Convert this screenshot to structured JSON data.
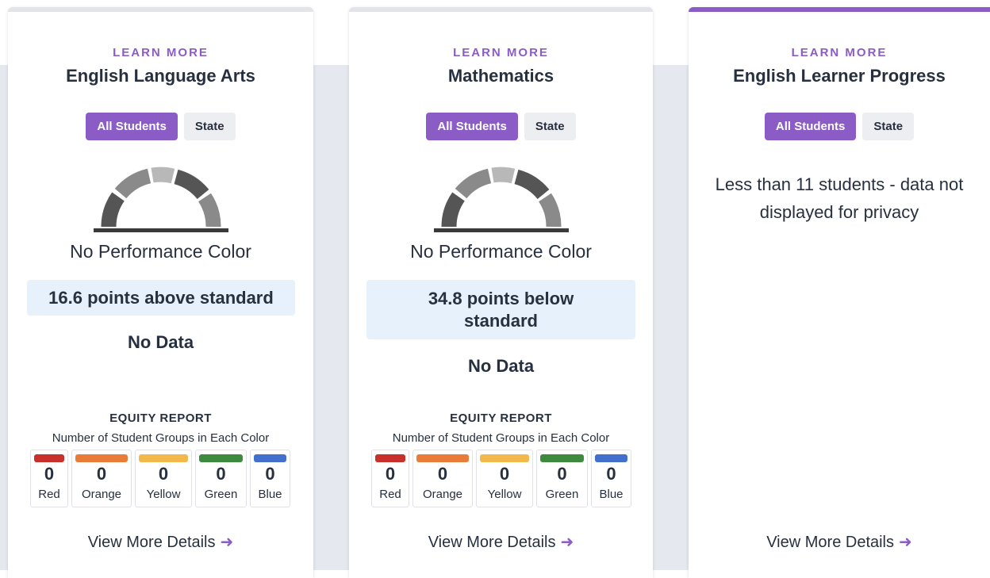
{
  "colors": {
    "accent": "#8b5cc6",
    "info_box": "#e7f1fb",
    "red": "#c9302c",
    "orange": "#ea7c3a",
    "yellow": "#f2b84b",
    "green": "#3e8a3f",
    "blue": "#4270cc"
  },
  "cards": [
    {
      "learn_more": "LEARN MORE",
      "title": "English Language Arts",
      "toggle": {
        "all_students": "All Students",
        "state": "State"
      },
      "gauge_icon": "gauge-icon",
      "performance": "No Performance Color",
      "status": "16.6 points above standard",
      "change": "No Data",
      "equity": {
        "title": "EQUITY REPORT",
        "subtitle": "Number of Student Groups in Each Color",
        "groups": [
          {
            "label": "Red",
            "count": "0"
          },
          {
            "label": "Orange",
            "count": "0"
          },
          {
            "label": "Yellow",
            "count": "0"
          },
          {
            "label": "Green",
            "count": "0"
          },
          {
            "label": "Blue",
            "count": "0"
          }
        ]
      },
      "view_more": "View More Details"
    },
    {
      "learn_more": "LEARN MORE",
      "title": "Mathematics",
      "toggle": {
        "all_students": "All Students",
        "state": "State"
      },
      "gauge_icon": "gauge-icon",
      "performance": "No Performance Color",
      "status": "34.8 points below standard",
      "change": "No Data",
      "equity": {
        "title": "EQUITY REPORT",
        "subtitle": "Number of Student Groups in Each Color",
        "groups": [
          {
            "label": "Red",
            "count": "0"
          },
          {
            "label": "Orange",
            "count": "0"
          },
          {
            "label": "Yellow",
            "count": "0"
          },
          {
            "label": "Green",
            "count": "0"
          },
          {
            "label": "Blue",
            "count": "0"
          }
        ]
      },
      "view_more": "View More Details"
    },
    {
      "learn_more": "LEARN MORE",
      "title": "English Learner Progress",
      "toggle": {
        "all_students": "All Students",
        "state": "State"
      },
      "message": "Less than 11 students - data not displayed for privacy",
      "view_more": "View More Details"
    }
  ]
}
